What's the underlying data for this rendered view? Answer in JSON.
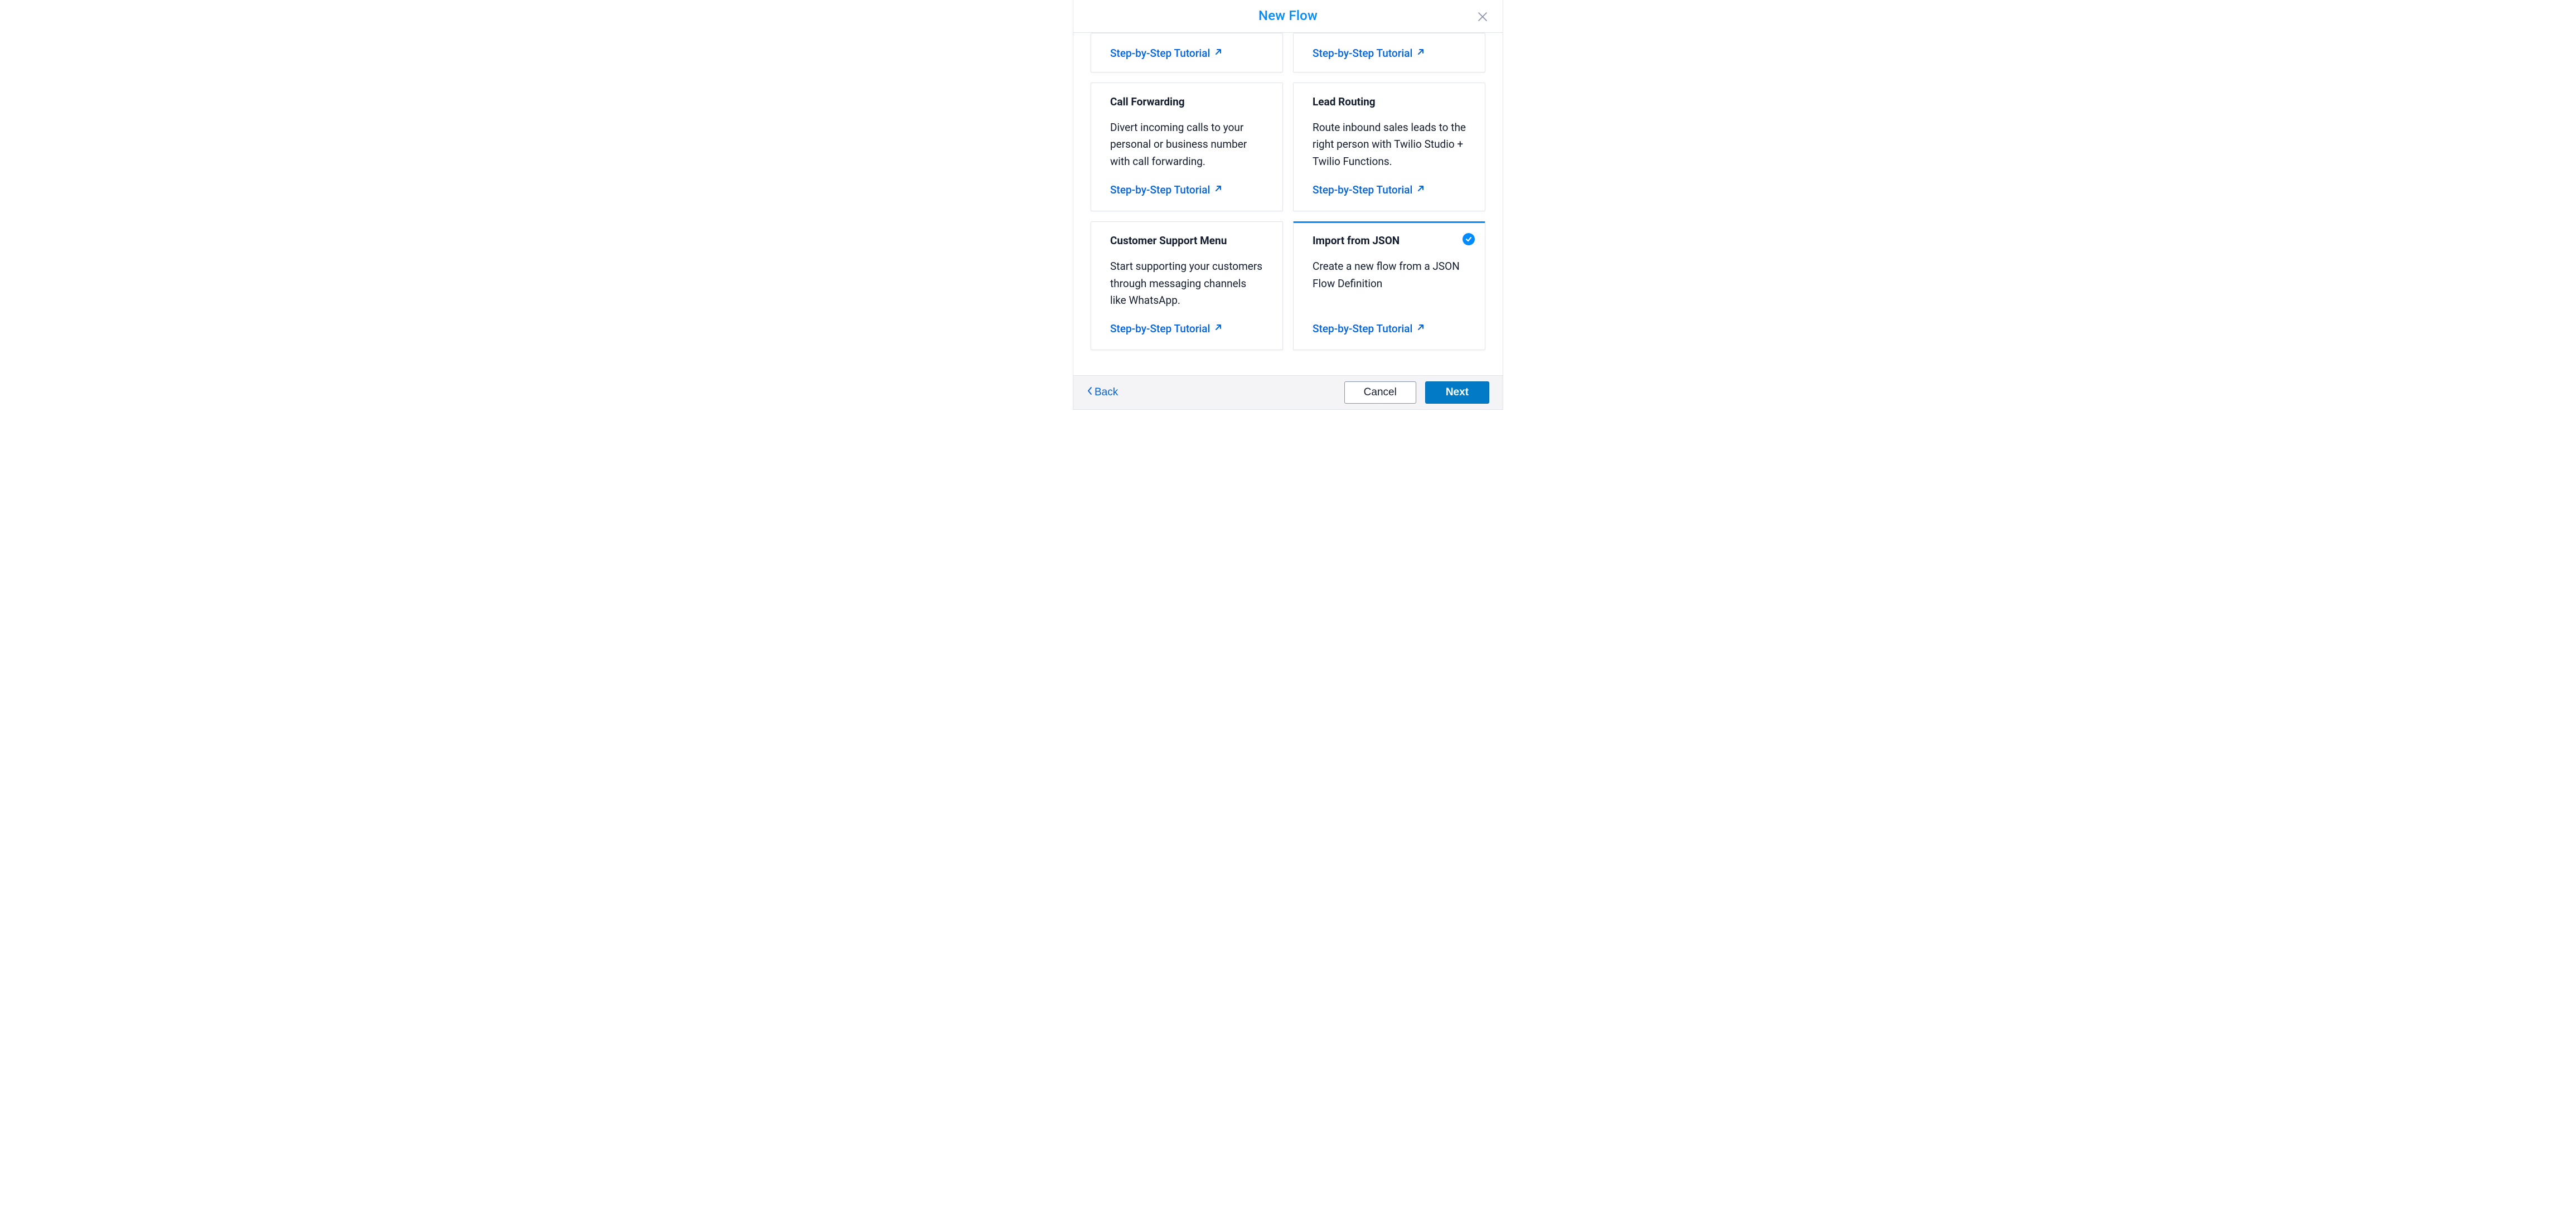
{
  "modal": {
    "title": "New Flow",
    "footer": {
      "back": "Back",
      "cancel": "Cancel",
      "next": "Next"
    }
  },
  "link_label": "Step-by-Step Tutorial",
  "cards": [
    {
      "id": "partial-a",
      "title": "",
      "desc": "",
      "link": "Step-by-Step Tutorial",
      "partial_top": true,
      "selected": false
    },
    {
      "id": "partial-b",
      "title": "",
      "desc": "",
      "link": "Step-by-Step Tutorial",
      "partial_top": true,
      "selected": false
    },
    {
      "id": "call-forwarding",
      "title": "Call Forwarding",
      "desc": "Divert incoming calls to your personal or business number with call forwarding.",
      "link": "Step-by-Step Tutorial",
      "partial_top": false,
      "selected": false
    },
    {
      "id": "lead-routing",
      "title": "Lead Routing",
      "desc": "Route inbound sales leads to the right person with Twilio Studio + Twilio Functions.",
      "link": "Step-by-Step Tutorial",
      "partial_top": false,
      "selected": false
    },
    {
      "id": "customer-support-menu",
      "title": "Customer Support Menu",
      "desc": "Start supporting your customers through messaging channels like WhatsApp.",
      "link": "Step-by-Step Tutorial",
      "partial_top": false,
      "selected": false
    },
    {
      "id": "import-from-json",
      "title": "Import from JSON",
      "desc": "Create a new flow from a JSON Flow Definition",
      "link": "Step-by-Step Tutorial",
      "partial_top": false,
      "selected": true
    }
  ]
}
